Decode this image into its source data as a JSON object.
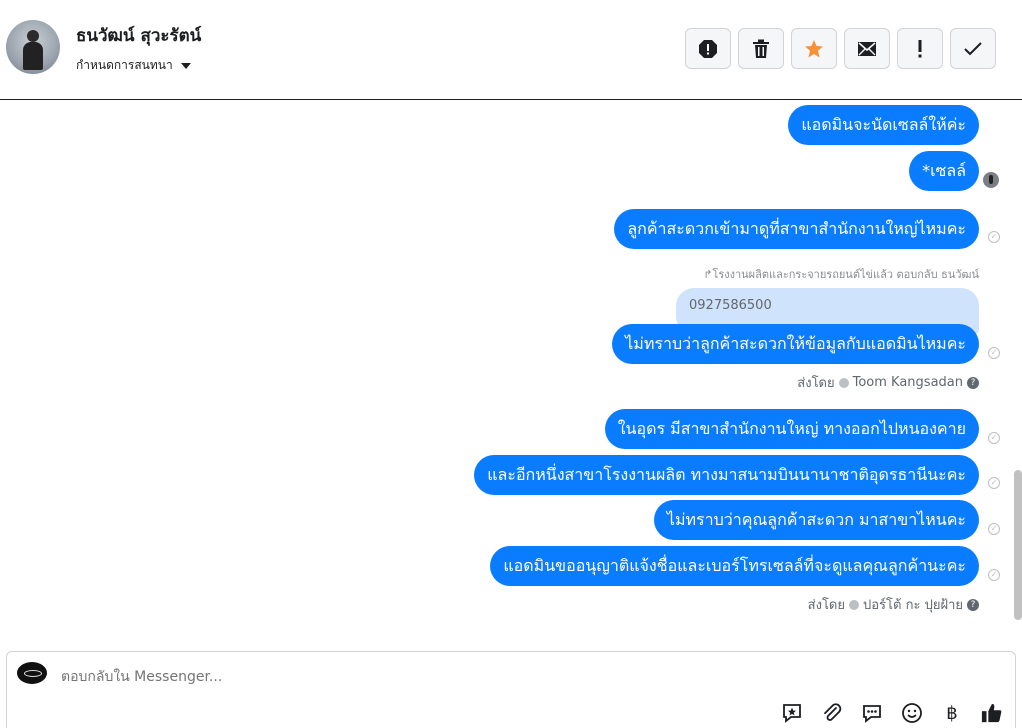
{
  "header": {
    "name": "ธนวัฒน์ สุวะรัตน์",
    "assign_label": "กำหนดการสนทนา",
    "actions": [
      {
        "icon": "alert-octagon-icon",
        "glyph": "!"
      },
      {
        "icon": "trash-icon",
        "glyph": "🗑"
      },
      {
        "icon": "star-icon",
        "glyph": "★"
      },
      {
        "icon": "envelope-icon",
        "glyph": "✉"
      },
      {
        "icon": "exclamation-icon",
        "glyph": "!"
      },
      {
        "icon": "check-icon",
        "glyph": "✓"
      }
    ]
  },
  "messages": {
    "m1": "แอดมินจะนัดเซลล์ให้ค่ะ",
    "m2": "*เซลล์",
    "m3": "ลูกค้าสะดวกเข้ามาดูที่สาขาสำนักงานใหญ่ไหมคะ",
    "reply_note": "โรงงานผลิตและกระจายรถยนต์ไข่แล้ว ตอบกลับ ธนวัฒน์",
    "quoted": "0927586500",
    "m4": "ไม่ทราบว่าลูกค้าสะดวกให้ข้อมูลกับแอดมินไหมคะ",
    "sent_by_1_prefix": "ส่งโดย",
    "sent_by_1_name": "Toom Kangsadan",
    "m5": "ในอุดร มีสาขาสำนักงานใหญ่ ทางออกไปหนองคาย",
    "m6": "และอีกหนึ่งสาขาโรงงานผลิต ทางมาสนามบินนานาชาติอุดรธานีนะคะ",
    "m7": "ไม่ทราบว่าคุณลูกค้าสะดวก มาสาขาไหนคะ",
    "m8": "แอดมินขออนุญาติแจ้งชื่อและเบอร์โทรเซลล์ที่จะดูแลคุณลูกค้านะคะ",
    "sent_by_2_prefix": "ส่งโดย",
    "sent_by_2_name": "ปอร์โต้ กะ ปุยฝ้าย"
  },
  "composer": {
    "placeholder": "ตอบกลับใน Messenger...",
    "tools": [
      "quick-reply-icon",
      "attach-icon",
      "saved-reply-icon",
      "emoji-icon",
      "baht-icon",
      "like-icon"
    ]
  },
  "colors": {
    "bubble": "#0a7cff",
    "quoted_bg": "#cfe3fc",
    "star": "#f7923a"
  }
}
